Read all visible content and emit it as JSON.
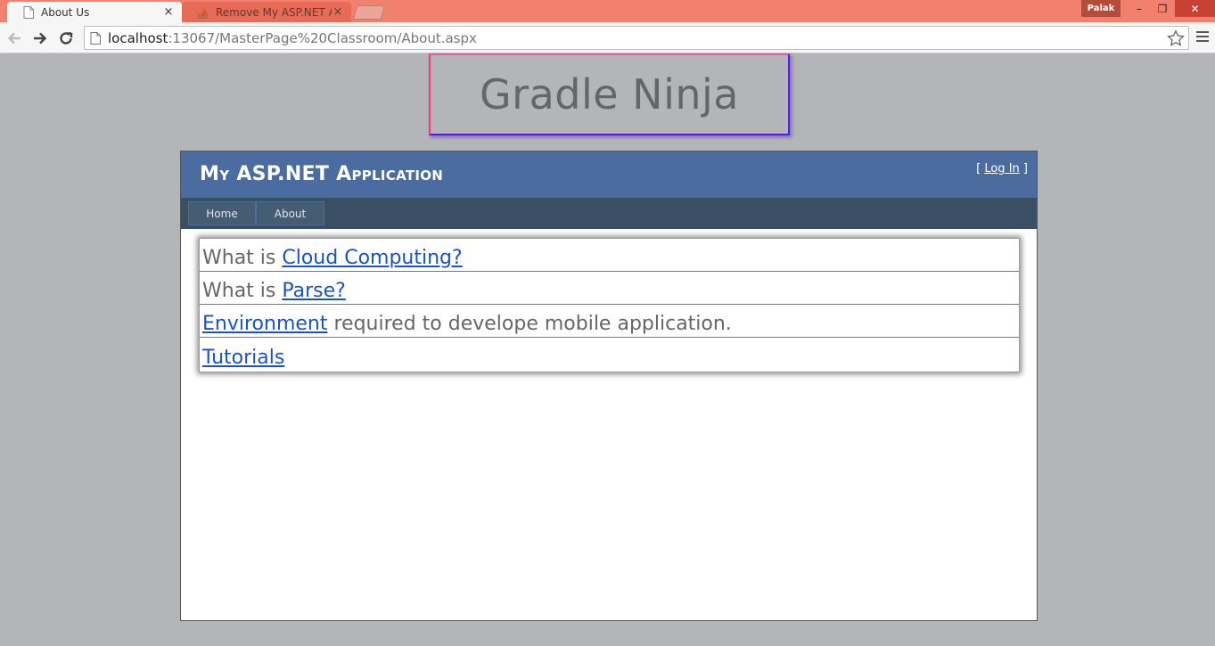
{
  "browser": {
    "tabs": [
      {
        "title": "About Us",
        "close": "×"
      },
      {
        "title": "Remove My ASP.NET App",
        "close": "×"
      }
    ],
    "profile_name": "Palak",
    "window_buttons": {
      "minimize": "–",
      "restore": "❐",
      "close": "✕"
    },
    "url_host": "localhost",
    "url_path": ":13067/MasterPage%20Classroom/About.aspx"
  },
  "page": {
    "banner": "Gradle Ninja",
    "app_title": "My ASP.NET Application",
    "login_prefix": "[ ",
    "login_link": "Log In",
    "login_suffix": " ]",
    "menu": [
      "Home",
      "About"
    ],
    "links": [
      {
        "prefix": "What is ",
        "link": "Cloud Computing?",
        "suffix": ""
      },
      {
        "prefix": "What is ",
        "link": "Parse?",
        "suffix": ""
      },
      {
        "prefix": "",
        "link": "Environment",
        "suffix": " required to develope mobile application."
      },
      {
        "prefix": "",
        "link": "Tutorials",
        "suffix": ""
      }
    ]
  },
  "colors": {
    "titlebar": "#f1806e",
    "header": "#4b6c9e",
    "menubar": "#3a4f63",
    "link": "#1a52c9"
  }
}
